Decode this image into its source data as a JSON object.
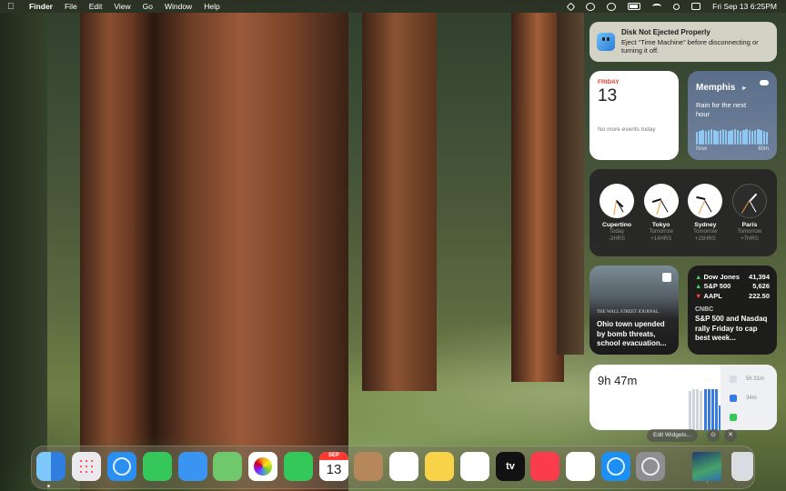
{
  "menubar": {
    "app_name": "Finder",
    "menus": [
      "File",
      "Edit",
      "View",
      "Go",
      "Window",
      "Help"
    ],
    "datetime": "Fri Sep 13  6:25PM"
  },
  "notification": {
    "title": "Disk Not Ejected Properly",
    "body": "Eject “Time Machine” before disconnecting or turning it off."
  },
  "calendar_widget": {
    "day": "FRIDAY",
    "date": "13",
    "empty_text": "No more events today"
  },
  "weather_widget": {
    "city": "Memphis",
    "location_arrow": "➤",
    "description": "Rain for the next hour",
    "axis_start": "Now",
    "axis_end": "60m",
    "rain_intensity": [
      0.8,
      0.85,
      0.9,
      0.85,
      0.9,
      0.95,
      0.9,
      0.85,
      0.9,
      0.95,
      0.9,
      0.85,
      0.9,
      0.95,
      0.9,
      0.85,
      0.9,
      0.95,
      0.9,
      0.85,
      0.9,
      0.95,
      0.9,
      0.85,
      0.8
    ]
  },
  "world_clock_widget": {
    "clocks": [
      {
        "city": "Cupertino",
        "day": "Today",
        "offset": "-2HRS",
        "hour": 4,
        "minute": 25,
        "dark": false
      },
      {
        "city": "Tokyo",
        "day": "Tomorrow",
        "offset": "+14HRS",
        "hour": 8,
        "minute": 25,
        "dark": false
      },
      {
        "city": "Sydney",
        "day": "Tomorrow",
        "offset": "+15HRS",
        "hour": 9,
        "minute": 25,
        "dark": false
      },
      {
        "city": "Paris",
        "day": "Tomorrow",
        "offset": "+7HRS",
        "hour": 1,
        "minute": 25,
        "dark": true
      }
    ]
  },
  "news_widget": {
    "source": "THE WALL STREET JOURNAL.",
    "headline": "Ohio town upended by bomb threats, school evacuation..."
  },
  "stocks_widget": {
    "stocks": [
      {
        "symbol": "Dow Jones",
        "value": "41,394",
        "direction": "up",
        "arrow": "▲"
      },
      {
        "symbol": "S&P 500",
        "value": "5,626",
        "direction": "up",
        "arrow": "▲"
      },
      {
        "symbol": "AAPL",
        "value": "222.50",
        "direction": "down",
        "arrow": "▼"
      }
    ],
    "source": "CNBC",
    "headline": "S&P 500 and Nasdaq rally Friday to cap best week..."
  },
  "screen_time_widget": {
    "total": "9h 47m",
    "grid_labels": [
      "60m",
      "30m"
    ],
    "apps": [
      {
        "time": "5h 31m",
        "color": "#d7dce6"
      },
      {
        "time": "34m",
        "color": "#3a7be0"
      },
      {
        "time": "",
        "color": "#34c759"
      }
    ],
    "hourly_bars": [
      {
        "value": 0.0,
        "color": "#cfd3da"
      },
      {
        "value": 0.0,
        "color": "#cfd3da"
      },
      {
        "value": 0.0,
        "color": "#cfd3da"
      },
      {
        "value": 0.0,
        "color": "#cfd3da"
      },
      {
        "value": 0.0,
        "color": "#cfd3da"
      },
      {
        "value": 0.0,
        "color": "#cfd3da"
      },
      {
        "value": 0.0,
        "color": "#cfd3da"
      },
      {
        "value": 0.0,
        "color": "#cfd3da"
      },
      {
        "value": 0.0,
        "color": "#cfd3da"
      },
      {
        "value": 0.0,
        "color": "#cfd3da"
      },
      {
        "value": 0.0,
        "color": "#cfd3da"
      },
      {
        "value": 0.0,
        "color": "#cfd3da"
      },
      {
        "value": 0.0,
        "color": "#cfd3da"
      },
      {
        "value": 0.0,
        "color": "#cfd3da"
      },
      {
        "value": 0.95,
        "color": "#cfd3da"
      },
      {
        "value": 1.0,
        "color": "#cfd3da"
      },
      {
        "value": 1.0,
        "color": "#cfd3da"
      },
      {
        "value": 0.95,
        "color": "#cfd3da"
      },
      {
        "value": 1.0,
        "color": "#3a7be0"
      },
      {
        "value": 1.0,
        "color": "#3a7be0"
      },
      {
        "value": 1.0,
        "color": "#3a7be0"
      },
      {
        "value": 1.0,
        "color": "#3a7be0"
      },
      {
        "value": 0.6,
        "color": "#3a7be0"
      },
      {
        "value": 0.0,
        "color": "#cfd3da"
      }
    ]
  },
  "widget_controls": {
    "edit_label": "Edit Widgets...",
    "info_glyph": "⊙",
    "close_glyph": "✕"
  },
  "dock": {
    "calendar_month": "SEP",
    "calendar_day": "13",
    "tv_label": "tv",
    "apps": [
      {
        "name": "Finder",
        "color": "#3d8ef0"
      },
      {
        "name": "Launchpad",
        "color": "#e9e9ee"
      },
      {
        "name": "Safari",
        "color": "#2a8ff0"
      },
      {
        "name": "Messages",
        "color": "#35c759"
      },
      {
        "name": "Mail",
        "color": "#3a95f2"
      },
      {
        "name": "Maps",
        "color": "#6fc86c"
      },
      {
        "name": "Photos",
        "color": "#ffffff"
      },
      {
        "name": "FaceTime",
        "color": "#34c759"
      },
      {
        "name": "Calendar",
        "color": "#ffffff"
      },
      {
        "name": "Contacts",
        "color": "#b5875a"
      },
      {
        "name": "Reminders",
        "color": "#ffffff"
      },
      {
        "name": "Notes",
        "color": "#f8d34a"
      },
      {
        "name": "Freeform",
        "color": "#ffffff"
      },
      {
        "name": "TV",
        "color": "#111111"
      },
      {
        "name": "Music",
        "color": "#fa3c4c"
      },
      {
        "name": "News",
        "color": "#ffffff"
      },
      {
        "name": "App Store",
        "color": "#1c8ff4"
      },
      {
        "name": "System Settings",
        "color": "#8e8e93"
      },
      {
        "name": "Downloads",
        "color": "#3a7ac9"
      },
      {
        "name": "Trash",
        "color": "#d9dde2"
      }
    ]
  }
}
